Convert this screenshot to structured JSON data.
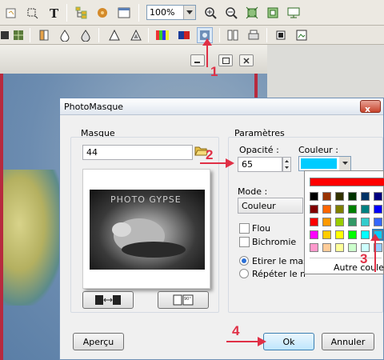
{
  "toolbar": {
    "zoom_value": "100%",
    "icons_row1": [
      "open-icon",
      "crop-icon",
      "text-icon",
      "hierarchy-icon",
      "plugin-icon",
      "window-icon",
      "zoom-in-icon",
      "zoom-out-icon",
      "fit-icon",
      "fullscreen-icon",
      "display-icon"
    ],
    "icons_row2": [
      "grid-icon",
      "mosaic-icon",
      "flip-icon",
      "drop-icon",
      "drop-outline-icon",
      "triangle-icon",
      "triangle-outline-icon",
      "color-bars-icon",
      "rgb-icon",
      "photomask-icon",
      "frame-icon",
      "print-icon",
      "export-icon",
      "save-icon"
    ]
  },
  "dialog": {
    "title": "PhotoMasque",
    "close_label": "x",
    "masque": {
      "group_label": "Masque",
      "value": "44",
      "preview_text": "PHOTO GYPSE"
    },
    "parametres": {
      "group_label": "Paramètres",
      "opacite_label": "Opacité :",
      "opacite_value": "65",
      "couleur_label": "Couleur :",
      "couleur_value": "#00ccff",
      "mode_label": "Mode :",
      "mode_value": "Couleur",
      "flou_label": "Flou",
      "bichromie_label": "Bichromie",
      "etirer_label": "Etirer le masque",
      "repeter_label": "Répéter le masque",
      "autre_couleur_label": "Autre couleur"
    },
    "buttons": {
      "apercu": "Aperçu",
      "ok": "Ok",
      "annuler": "Annuler"
    }
  },
  "palette": {
    "top_color": "#ff0000",
    "rows": [
      [
        "#000000",
        "#993300",
        "#333300",
        "#003300",
        "#003366",
        "#000080",
        "#333399"
      ],
      [
        "#800000",
        "#ff6600",
        "#808000",
        "#008000",
        "#008080",
        "#0000ff",
        "#666699"
      ],
      [
        "#ff0000",
        "#ff9900",
        "#99cc00",
        "#339966",
        "#33cccc",
        "#3366ff",
        "#800080"
      ],
      [
        "#ff00ff",
        "#ffcc00",
        "#ffff00",
        "#00ff00",
        "#00ffff",
        "#00ccff",
        "#993366"
      ],
      [
        "#ff99cc",
        "#ffcc99",
        "#ffff99",
        "#ccffcc",
        "#ccffff",
        "#99ccff",
        "#cc99ff"
      ]
    ]
  },
  "annotations": [
    "1",
    "2",
    "3",
    "4"
  ],
  "colors": {
    "annotation": "#e03046",
    "selected_color": "#00ccff"
  }
}
